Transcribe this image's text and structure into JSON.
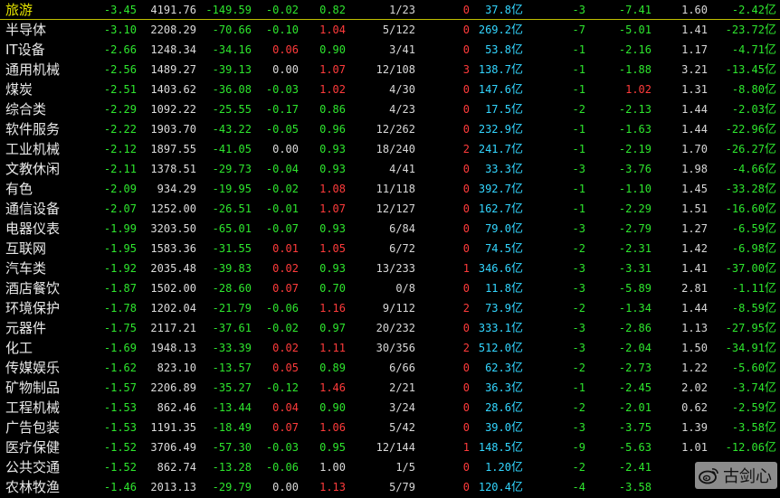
{
  "colors": {
    "up": "#ff3b3b",
    "down": "#2ee62e",
    "flat": "#dcdcdc",
    "amount": "#33d6ff",
    "name": "#e9e9e9",
    "selected_name": "#e6e600"
  },
  "watermark": {
    "icon": "weibo-icon",
    "text": "古剑心"
  },
  "rows": [
    {
      "name": "旅游",
      "c1": "-3.45",
      "c2": "4191.76",
      "c3": "-149.59",
      "c4": "-0.02",
      "c5": "0.82",
      "c6": "1/23",
      "c7": "0",
      "c8": "37.8",
      "c8u": "亿",
      "c9": "-3",
      "c10": "-7.41",
      "c11": "1.60",
      "c12": "-2.42",
      "c12u": "亿",
      "col": {
        "c3": "g",
        "c4": "g",
        "c5": "g",
        "c7": "r",
        "c9": "g",
        "c10": "g",
        "c12": "g"
      }
    },
    {
      "name": "半导体",
      "c1": "-3.10",
      "c2": "2208.29",
      "c3": "-70.66",
      "c4": "-0.10",
      "c5": "1.04",
      "c6": "5/122",
      "c7": "0",
      "c8": "269.2",
      "c8u": "亿",
      "c9": "-7",
      "c10": "-5.01",
      "c11": "1.41",
      "c12": "-23.72",
      "c12u": "亿",
      "col": {
        "c3": "g",
        "c4": "g",
        "c5": "r",
        "c7": "r",
        "c9": "g",
        "c10": "g",
        "c12": "g"
      }
    },
    {
      "name": "IT设备",
      "c1": "-2.66",
      "c2": "1248.34",
      "c3": "-34.16",
      "c4": "0.06",
      "c5": "0.90",
      "c6": "3/41",
      "c7": "0",
      "c8": "53.8",
      "c8u": "亿",
      "c9": "-1",
      "c10": "-2.16",
      "c11": "1.17",
      "c12": "-4.71",
      "c12u": "亿",
      "col": {
        "c3": "g",
        "c4": "r",
        "c5": "g",
        "c7": "r",
        "c9": "g",
        "c10": "g",
        "c12": "g"
      }
    },
    {
      "name": "通用机械",
      "c1": "-2.56",
      "c2": "1489.27",
      "c3": "-39.13",
      "c4": "0.00",
      "c5": "1.07",
      "c6": "12/108",
      "c7": "3",
      "c8": "138.7",
      "c8u": "亿",
      "c9": "-1",
      "c10": "-1.88",
      "c11": "3.21",
      "c12": "-13.45",
      "c12u": "亿",
      "col": {
        "c3": "g",
        "c4": "w",
        "c5": "r",
        "c7": "r",
        "c9": "g",
        "c10": "g",
        "c12": "g"
      }
    },
    {
      "name": "煤炭",
      "c1": "-2.51",
      "c2": "1403.62",
      "c3": "-36.08",
      "c4": "-0.03",
      "c5": "1.02",
      "c6": "4/30",
      "c7": "0",
      "c8": "147.6",
      "c8u": "亿",
      "c9": "-1",
      "c10": "1.02",
      "c11": "1.31",
      "c12": "-8.80",
      "c12u": "亿",
      "col": {
        "c3": "g",
        "c4": "g",
        "c5": "r",
        "c7": "r",
        "c9": "g",
        "c10": "r",
        "c12": "g"
      }
    },
    {
      "name": "综合类",
      "c1": "-2.29",
      "c2": "1092.22",
      "c3": "-25.55",
      "c4": "-0.17",
      "c5": "0.86",
      "c6": "4/23",
      "c7": "0",
      "c8": "17.5",
      "c8u": "亿",
      "c9": "-2",
      "c10": "-2.13",
      "c11": "1.44",
      "c12": "-2.03",
      "c12u": "亿",
      "col": {
        "c3": "g",
        "c4": "g",
        "c5": "g",
        "c7": "r",
        "c9": "g",
        "c10": "g",
        "c12": "g"
      }
    },
    {
      "name": "软件服务",
      "c1": "-2.22",
      "c2": "1903.70",
      "c3": "-43.22",
      "c4": "-0.05",
      "c5": "0.96",
      "c6": "12/262",
      "c7": "0",
      "c8": "232.9",
      "c8u": "亿",
      "c9": "-1",
      "c10": "-1.63",
      "c11": "1.44",
      "c12": "-22.96",
      "c12u": "亿",
      "col": {
        "c3": "g",
        "c4": "g",
        "c5": "g",
        "c7": "r",
        "c9": "g",
        "c10": "g",
        "c12": "g"
      }
    },
    {
      "name": "工业机械",
      "c1": "-2.12",
      "c2": "1897.55",
      "c3": "-41.05",
      "c4": "0.00",
      "c5": "0.93",
      "c6": "18/240",
      "c7": "2",
      "c8": "241.7",
      "c8u": "亿",
      "c9": "-1",
      "c10": "-2.19",
      "c11": "1.70",
      "c12": "-26.27",
      "c12u": "亿",
      "col": {
        "c3": "g",
        "c4": "w",
        "c5": "g",
        "c7": "r",
        "c9": "g",
        "c10": "g",
        "c12": "g"
      }
    },
    {
      "name": "文教休闲",
      "c1": "-2.11",
      "c2": "1378.51",
      "c3": "-29.73",
      "c4": "-0.04",
      "c5": "0.93",
      "c6": "4/41",
      "c7": "0",
      "c8": "33.3",
      "c8u": "亿",
      "c9": "-3",
      "c10": "-3.76",
      "c11": "1.98",
      "c12": "-4.66",
      "c12u": "亿",
      "col": {
        "c3": "g",
        "c4": "g",
        "c5": "g",
        "c7": "r",
        "c9": "g",
        "c10": "g",
        "c12": "g"
      }
    },
    {
      "name": "有色",
      "c1": "-2.09",
      "c2": "934.29",
      "c3": "-19.95",
      "c4": "-0.02",
      "c5": "1.08",
      "c6": "11/118",
      "c7": "0",
      "c8": "392.7",
      "c8u": "亿",
      "c9": "-1",
      "c10": "-1.10",
      "c11": "1.45",
      "c12": "-33.28",
      "c12u": "亿",
      "col": {
        "c3": "g",
        "c4": "g",
        "c5": "r",
        "c7": "r",
        "c9": "g",
        "c10": "g",
        "c12": "g"
      }
    },
    {
      "name": "通信设备",
      "c1": "-2.07",
      "c2": "1252.00",
      "c3": "-26.51",
      "c4": "-0.01",
      "c5": "1.07",
      "c6": "12/127",
      "c7": "0",
      "c8": "162.7",
      "c8u": "亿",
      "c9": "-1",
      "c10": "-2.29",
      "c11": "1.51",
      "c12": "-16.60",
      "c12u": "亿",
      "col": {
        "c3": "g",
        "c4": "g",
        "c5": "r",
        "c7": "r",
        "c9": "g",
        "c10": "g",
        "c12": "g"
      }
    },
    {
      "name": "电器仪表",
      "c1": "-1.99",
      "c2": "3203.50",
      "c3": "-65.01",
      "c4": "-0.07",
      "c5": "0.93",
      "c6": "6/84",
      "c7": "0",
      "c8": "79.0",
      "c8u": "亿",
      "c9": "-3",
      "c10": "-2.79",
      "c11": "1.27",
      "c12": "-6.59",
      "c12u": "亿",
      "col": {
        "c3": "g",
        "c4": "g",
        "c5": "g",
        "c7": "r",
        "c9": "g",
        "c10": "g",
        "c12": "g"
      }
    },
    {
      "name": "互联网",
      "c1": "-1.95",
      "c2": "1583.36",
      "c3": "-31.55",
      "c4": "0.01",
      "c5": "1.05",
      "c6": "6/72",
      "c7": "0",
      "c8": "74.5",
      "c8u": "亿",
      "c9": "-2",
      "c10": "-2.31",
      "c11": "1.42",
      "c12": "-6.98",
      "c12u": "亿",
      "col": {
        "c3": "g",
        "c4": "r",
        "c5": "r",
        "c7": "r",
        "c9": "g",
        "c10": "g",
        "c12": "g"
      }
    },
    {
      "name": "汽车类",
      "c1": "-1.92",
      "c2": "2035.48",
      "c3": "-39.83",
      "c4": "0.02",
      "c5": "0.93",
      "c6": "13/233",
      "c7": "1",
      "c8": "346.6",
      "c8u": "亿",
      "c9": "-3",
      "c10": "-3.31",
      "c11": "1.41",
      "c12": "-37.00",
      "c12u": "亿",
      "col": {
        "c3": "g",
        "c4": "r",
        "c5": "g",
        "c7": "r",
        "c9": "g",
        "c10": "g",
        "c12": "g"
      }
    },
    {
      "name": "酒店餐饮",
      "c1": "-1.87",
      "c2": "1502.00",
      "c3": "-28.60",
      "c4": "0.07",
      "c5": "0.70",
      "c6": "0/8",
      "c7": "0",
      "c8": "11.8",
      "c8u": "亿",
      "c9": "-3",
      "c10": "-5.89",
      "c11": "2.81",
      "c12": "-1.11",
      "c12u": "亿",
      "col": {
        "c3": "g",
        "c4": "r",
        "c5": "g",
        "c7": "r",
        "c9": "g",
        "c10": "g",
        "c12": "g"
      }
    },
    {
      "name": "环境保护",
      "c1": "-1.78",
      "c2": "1202.04",
      "c3": "-21.79",
      "c4": "-0.06",
      "c5": "1.16",
      "c6": "9/112",
      "c7": "2",
      "c8": "73.9",
      "c8u": "亿",
      "c9": "-2",
      "c10": "-1.34",
      "c11": "1.44",
      "c12": "-8.59",
      "c12u": "亿",
      "col": {
        "c3": "g",
        "c4": "g",
        "c5": "r",
        "c7": "r",
        "c9": "g",
        "c10": "g",
        "c12": "g"
      }
    },
    {
      "name": "元器件",
      "c1": "-1.75",
      "c2": "2117.21",
      "c3": "-37.61",
      "c4": "-0.02",
      "c5": "0.97",
      "c6": "20/232",
      "c7": "0",
      "c8": "333.1",
      "c8u": "亿",
      "c9": "-3",
      "c10": "-2.86",
      "c11": "1.13",
      "c12": "-27.95",
      "c12u": "亿",
      "col": {
        "c3": "g",
        "c4": "g",
        "c5": "g",
        "c7": "r",
        "c9": "g",
        "c10": "g",
        "c12": "g"
      }
    },
    {
      "name": "化工",
      "c1": "-1.69",
      "c2": "1948.13",
      "c3": "-33.39",
      "c4": "0.02",
      "c5": "1.11",
      "c6": "30/356",
      "c7": "2",
      "c8": "512.0",
      "c8u": "亿",
      "c9": "-3",
      "c10": "-2.04",
      "c11": "1.50",
      "c12": "-34.91",
      "c12u": "亿",
      "col": {
        "c3": "g",
        "c4": "r",
        "c5": "r",
        "c7": "r",
        "c9": "g",
        "c10": "g",
        "c12": "g"
      }
    },
    {
      "name": "传媒娱乐",
      "c1": "-1.62",
      "c2": "823.10",
      "c3": "-13.57",
      "c4": "0.05",
      "c5": "0.89",
      "c6": "6/66",
      "c7": "0",
      "c8": "62.3",
      "c8u": "亿",
      "c9": "-2",
      "c10": "-2.73",
      "c11": "1.22",
      "c12": "-5.60",
      "c12u": "亿",
      "col": {
        "c3": "g",
        "c4": "r",
        "c5": "g",
        "c7": "r",
        "c9": "g",
        "c10": "g",
        "c12": "g"
      }
    },
    {
      "name": "矿物制品",
      "c1": "-1.57",
      "c2": "2206.89",
      "c3": "-35.27",
      "c4": "-0.12",
      "c5": "1.46",
      "c6": "2/21",
      "c7": "0",
      "c8": "36.3",
      "c8u": "亿",
      "c9": "-1",
      "c10": "-2.45",
      "c11": "2.02",
      "c12": "-3.74",
      "c12u": "亿",
      "col": {
        "c3": "g",
        "c4": "g",
        "c5": "r",
        "c7": "r",
        "c9": "g",
        "c10": "g",
        "c12": "g"
      }
    },
    {
      "name": "工程机械",
      "c1": "-1.53",
      "c2": "862.46",
      "c3": "-13.44",
      "c4": "0.04",
      "c5": "0.90",
      "c6": "3/24",
      "c7": "0",
      "c8": "28.6",
      "c8u": "亿",
      "c9": "-2",
      "c10": "-2.01",
      "c11": "0.62",
      "c12": "-2.59",
      "c12u": "亿",
      "col": {
        "c3": "g",
        "c4": "r",
        "c5": "g",
        "c7": "r",
        "c9": "g",
        "c10": "g",
        "c12": "g"
      }
    },
    {
      "name": "广告包装",
      "c1": "-1.53",
      "c2": "1191.35",
      "c3": "-18.49",
      "c4": "0.07",
      "c5": "1.06",
      "c6": "5/42",
      "c7": "0",
      "c8": "39.0",
      "c8u": "亿",
      "c9": "-3",
      "c10": "-3.75",
      "c11": "1.39",
      "c12": "-3.58",
      "c12u": "亿",
      "col": {
        "c3": "g",
        "c4": "r",
        "c5": "r",
        "c7": "r",
        "c9": "g",
        "c10": "g",
        "c12": "g"
      }
    },
    {
      "name": "医疗保健",
      "c1": "-1.52",
      "c2": "3706.49",
      "c3": "-57.30",
      "c4": "-0.03",
      "c5": "0.95",
      "c6": "12/144",
      "c7": "1",
      "c8": "148.5",
      "c8u": "亿",
      "c9": "-9",
      "c10": "-5.63",
      "c11": "1.01",
      "c12": "-12.06",
      "c12u": "亿",
      "col": {
        "c3": "g",
        "c4": "g",
        "c5": "g",
        "c7": "r",
        "c9": "g",
        "c10": "g",
        "c12": "g"
      }
    },
    {
      "name": "公共交通",
      "c1": "-1.52",
      "c2": "862.74",
      "c3": "-13.28",
      "c4": "-0.06",
      "c5": "1.00",
      "c6": "1/5",
      "c7": "0",
      "c8": "1.20",
      "c8u": "亿",
      "c9": "-2",
      "c10": "-2.41",
      "c11": "",
      "c12": "",
      "c12u": "",
      "col": {
        "c3": "g",
        "c4": "g",
        "c5": "w",
        "c7": "r",
        "c9": "g",
        "c10": "g",
        "c12": "g"
      }
    },
    {
      "name": "农林牧渔",
      "c1": "-1.46",
      "c2": "2013.13",
      "c3": "-29.79",
      "c4": "0.00",
      "c5": "1.13",
      "c6": "5/79",
      "c7": "0",
      "c8": "120.4",
      "c8u": "亿",
      "c9": "-4",
      "c10": "-3.58",
      "c11": "",
      "c12": "",
      "c12u": "",
      "col": {
        "c3": "g",
        "c4": "w",
        "c5": "r",
        "c7": "r",
        "c9": "g",
        "c10": "g",
        "c12": "g"
      }
    }
  ]
}
